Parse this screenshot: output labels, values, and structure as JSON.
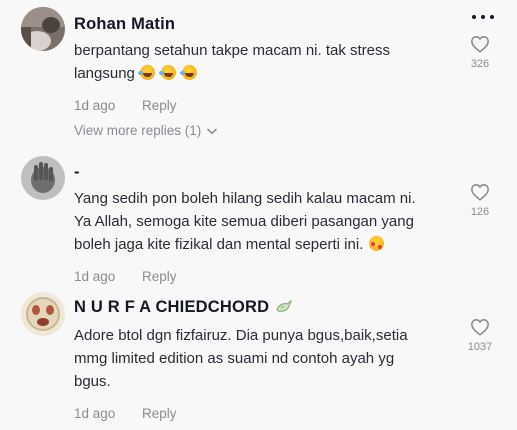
{
  "comments": [
    {
      "name": "Rohan Matin",
      "text_line1": "berpantang setahun takpe macam ni. tak stress",
      "text_line2": "langsung",
      "date": "1d ago",
      "reply": "Reply",
      "likes": "326",
      "emojis": [
        "rolling-on-floor-laughing-emoji",
        "rolling-on-floor-laughing-emoji",
        "rolling-on-floor-laughing-emoji"
      ]
    },
    {
      "name": "-",
      "text_line1": "Yang sedih pon boleh hilang sedih kalau macam ni.",
      "text_line2": "Ya Allah, semoga kite semua diberi pasangan yang",
      "text_line3": "boleh jaga kite fizikal dan mental seperti ini.",
      "date": "1d ago",
      "reply": "Reply",
      "likes": "126",
      "emojis": [
        "smiling-face-with-hearts-emoji"
      ]
    },
    {
      "name": "N U R F A CHIEDCHORD",
      "name_badge": "dove-icon",
      "text_line1": "Adore btol dgn fizfairuz. Dia punya bgus,baik,setia",
      "text_line2": "mmg limited edition as suami nd contoh ayah yg",
      "text_line3": "bgus.",
      "date": "1d ago",
      "reply": "Reply",
      "likes": "1037"
    }
  ],
  "view_more": "View more replies (1)",
  "colors": {
    "background": "#f8f8f8",
    "name": "#161823",
    "text": "#2b2d36",
    "muted": "#8a8b91"
  }
}
